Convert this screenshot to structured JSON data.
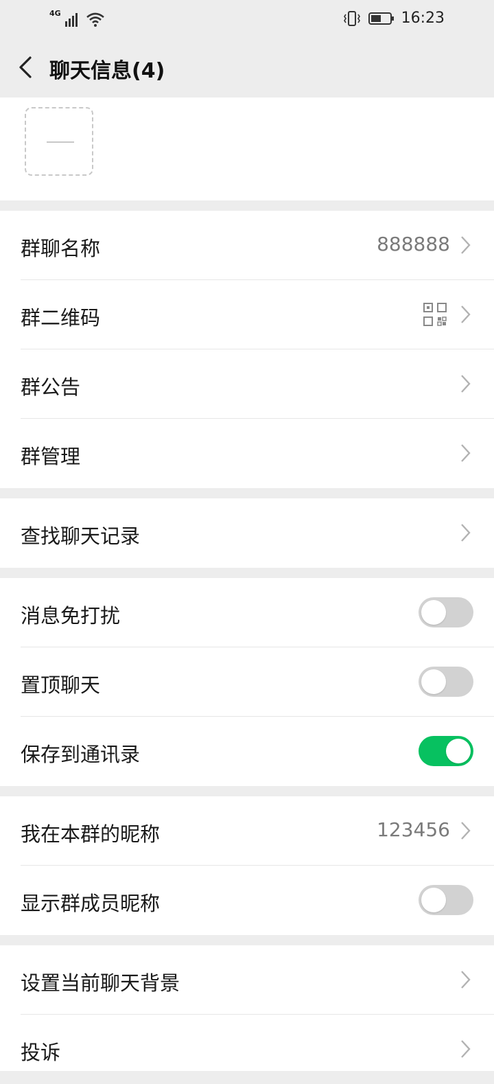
{
  "status_bar": {
    "network": "4G",
    "time": "16:23"
  },
  "nav": {
    "title": "聊天信息(4)"
  },
  "group_info": {
    "items": [
      {
        "label": "群聊名称",
        "value": "888888"
      },
      {
        "label": "群二维码"
      },
      {
        "label": "群公告"
      },
      {
        "label": "群管理"
      }
    ]
  },
  "search": {
    "items": [
      {
        "label": "查找聊天记录"
      }
    ]
  },
  "toggles": {
    "items": [
      {
        "label": "消息免打扰",
        "on": false
      },
      {
        "label": "置顶聊天",
        "on": false
      },
      {
        "label": "保存到通讯录",
        "on": true
      }
    ]
  },
  "nickname": {
    "items": [
      {
        "label": "我在本群的昵称",
        "value": "123456"
      },
      {
        "label": "显示群成员昵称",
        "on": false
      }
    ]
  },
  "misc": {
    "items": [
      {
        "label": "设置当前聊天背景"
      },
      {
        "label": "投诉"
      }
    ]
  },
  "colors": {
    "accent": "#07c160",
    "background": "#ededed"
  }
}
